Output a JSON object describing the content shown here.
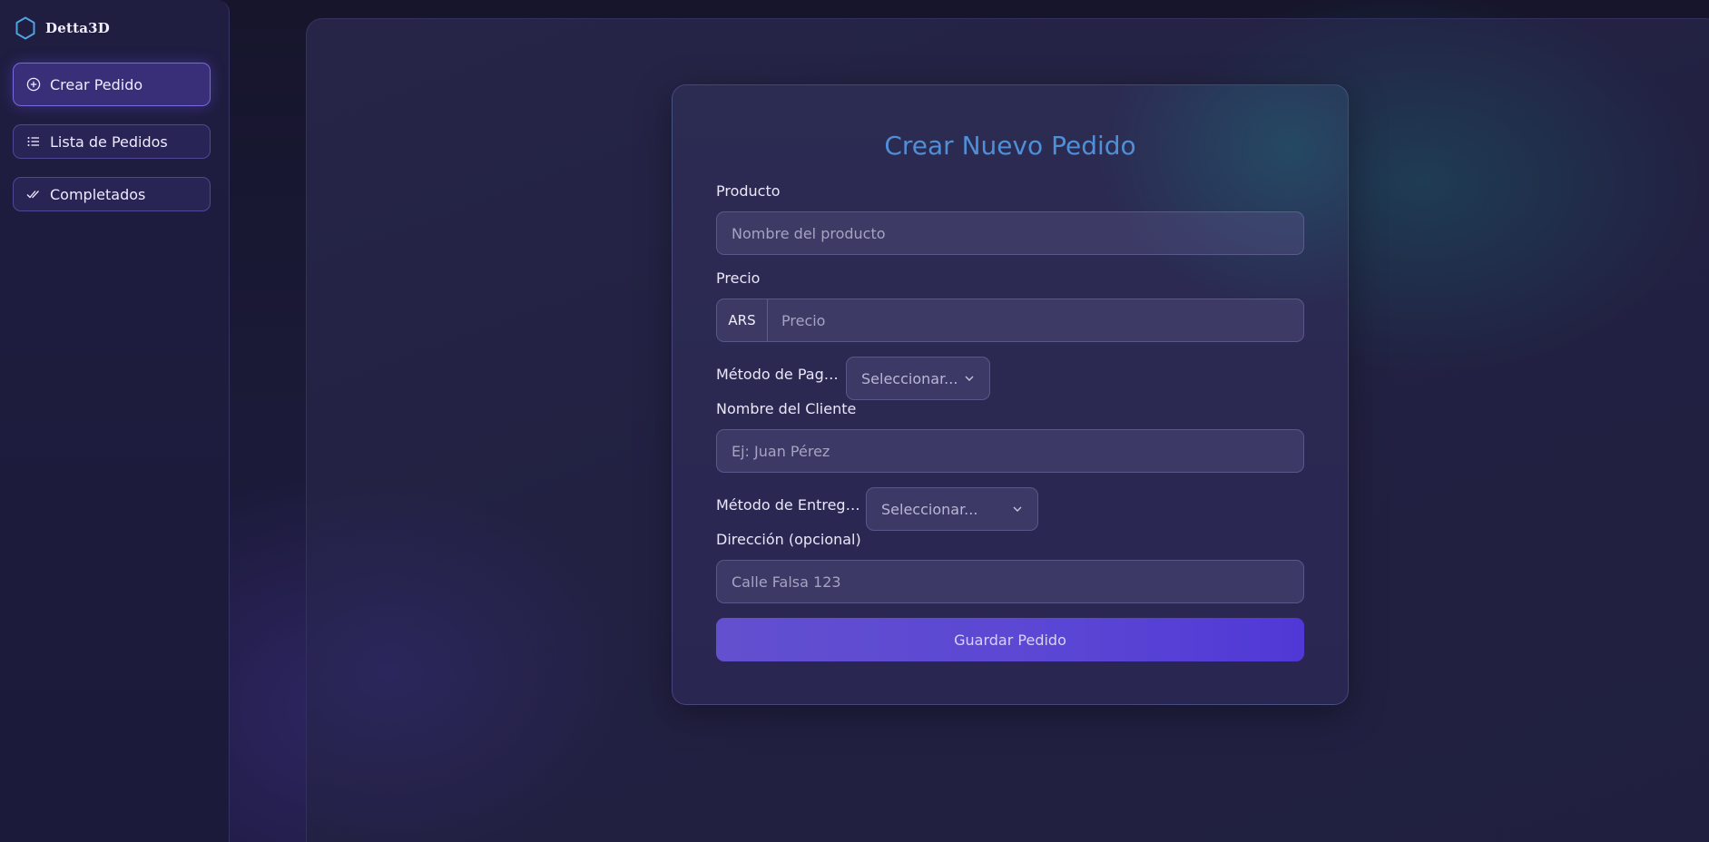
{
  "app": {
    "brand": "Detta3D"
  },
  "sidebar": {
    "items": [
      {
        "label": "Crear Pedido",
        "icon": "plus-circle-icon",
        "active": true
      },
      {
        "label": "Lista de Pedidos",
        "icon": "list-icon",
        "active": false
      },
      {
        "label": "Completados",
        "icon": "double-check-icon",
        "active": false
      }
    ]
  },
  "form": {
    "title": "Crear Nuevo Pedido",
    "producto": {
      "label": "Producto",
      "placeholder": "Nombre del producto"
    },
    "precio": {
      "label": "Precio",
      "currency": "ARS",
      "placeholder": "Precio"
    },
    "metodo_pago": {
      "label": "Método de Pago ...",
      "value": "Seleccionar..."
    },
    "cliente": {
      "label": "Nombre del Cliente",
      "placeholder": "Ej: Juan Pérez"
    },
    "metodo_entrega": {
      "label": "Método de Entrega ...",
      "value": "Seleccionar..."
    },
    "direccion": {
      "label": "Dirección (opcional)",
      "placeholder": "Calle Falsa 123"
    },
    "submit_label": "Guardar Pedido"
  },
  "colors": {
    "accent": "#5a46d4",
    "title": "#4f8fd8",
    "logo": "#4fa3e0"
  }
}
